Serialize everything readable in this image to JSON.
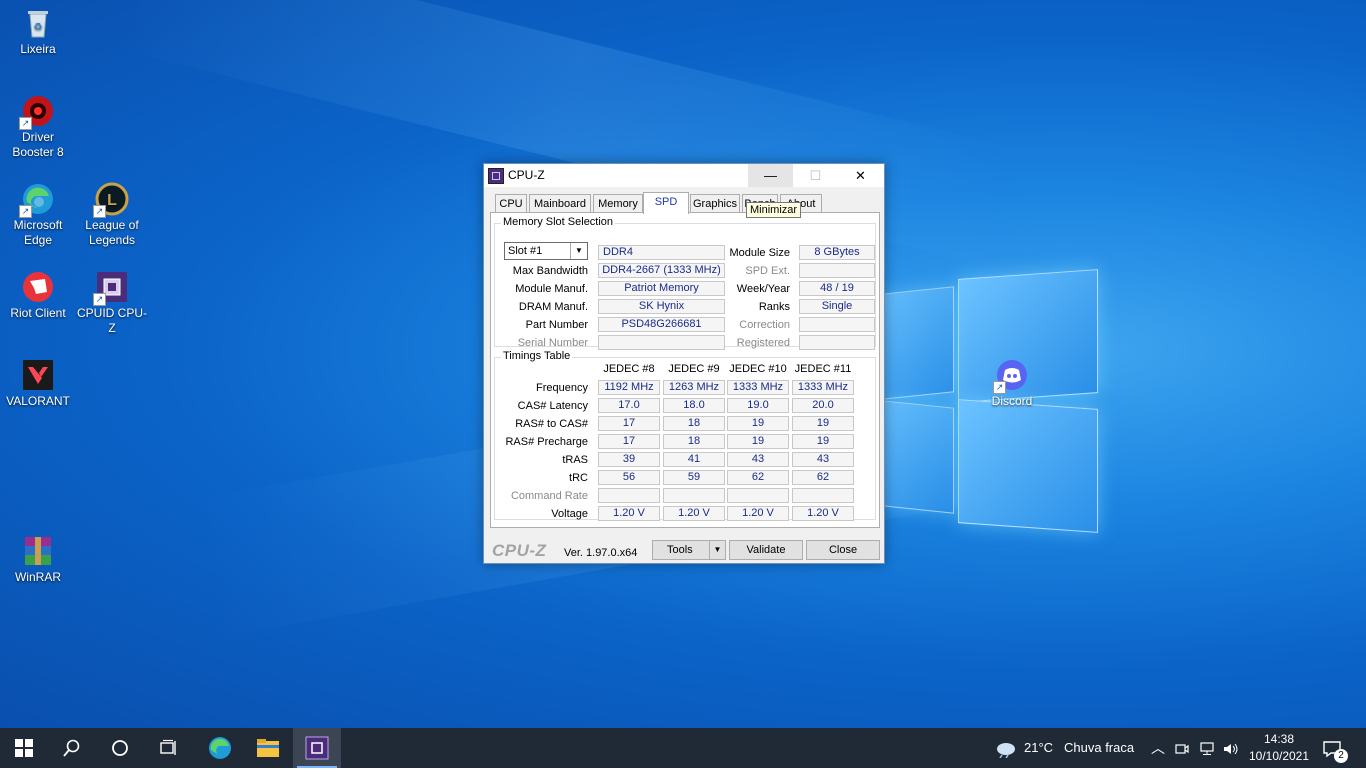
{
  "desktop": {
    "icons": [
      {
        "label": "Lixeira",
        "icon": "recycle-bin-icon"
      },
      {
        "label": "Driver Booster 8",
        "icon": "driver-booster-icon"
      },
      {
        "label": "Microsoft Edge",
        "icon": "edge-icon"
      },
      {
        "label": "League of Legends",
        "icon": "league-of-legends-icon"
      },
      {
        "label": "Riot Client",
        "icon": "riot-client-icon"
      },
      {
        "label": "CPUID CPU-Z",
        "icon": "cpuz-icon"
      },
      {
        "label": "VALORANT",
        "icon": "valorant-icon"
      },
      {
        "label": "WinRAR",
        "icon": "winrar-icon"
      },
      {
        "label": "Discord",
        "icon": "discord-icon"
      }
    ]
  },
  "window": {
    "title": "CPU-Z",
    "tooltip": "Minimizar",
    "tabs": [
      "CPU",
      "Mainboard",
      "Memory",
      "SPD",
      "Graphics",
      "Bench",
      "About"
    ],
    "active_tab": "SPD",
    "slot_group": {
      "title": "Memory Slot Selection",
      "slot": "Slot #1",
      "type": "DDR4",
      "module_size_label": "Module Size",
      "module_size": "8 GBytes",
      "max_bandwidth_label": "Max Bandwidth",
      "max_bandwidth": "DDR4-2667 (1333 MHz)",
      "spd_ext_label": "SPD Ext.",
      "spd_ext": "",
      "module_manuf_label": "Module Manuf.",
      "module_manuf": "Patriot Memory",
      "week_year_label": "Week/Year",
      "week_year": "48 / 19",
      "dram_manuf_label": "DRAM Manuf.",
      "dram_manuf": "SK Hynix",
      "ranks_label": "Ranks",
      "ranks": "Single",
      "part_number_label": "Part Number",
      "part_number": "PSD48G266681",
      "correction_label": "Correction",
      "correction": "",
      "serial_number_label": "Serial Number",
      "serial_number": "",
      "registered_label": "Registered",
      "registered": ""
    },
    "timings": {
      "title": "Timings Table",
      "columns": [
        "JEDEC #8",
        "JEDEC #9",
        "JEDEC #10",
        "JEDEC #11"
      ],
      "rows": [
        {
          "label": "Frequency",
          "values": [
            "1192 MHz",
            "1263 MHz",
            "1333 MHz",
            "1333 MHz"
          ],
          "dim": false
        },
        {
          "label": "CAS# Latency",
          "values": [
            "17.0",
            "18.0",
            "19.0",
            "20.0"
          ],
          "dim": false
        },
        {
          "label": "RAS# to CAS#",
          "values": [
            "17",
            "18",
            "19",
            "19"
          ],
          "dim": false
        },
        {
          "label": "RAS# Precharge",
          "values": [
            "17",
            "18",
            "19",
            "19"
          ],
          "dim": false
        },
        {
          "label": "tRAS",
          "values": [
            "39",
            "41",
            "43",
            "43"
          ],
          "dim": false
        },
        {
          "label": "tRC",
          "values": [
            "56",
            "59",
            "62",
            "62"
          ],
          "dim": false
        },
        {
          "label": "Command Rate",
          "values": [
            "",
            "",
            "",
            ""
          ],
          "dim": true
        },
        {
          "label": "Voltage",
          "values": [
            "1.20 V",
            "1.20 V",
            "1.20 V",
            "1.20 V"
          ],
          "dim": false
        }
      ]
    },
    "footer": {
      "brand": "CPU-Z",
      "version": "Ver. 1.97.0.x64",
      "tools": "Tools",
      "validate": "Validate",
      "close": "Close"
    }
  },
  "taskbar": {
    "weather_temp": "21°C",
    "weather_text": "Chuva fraca",
    "time": "14:38",
    "date": "10/10/2021",
    "notifications": "2"
  }
}
